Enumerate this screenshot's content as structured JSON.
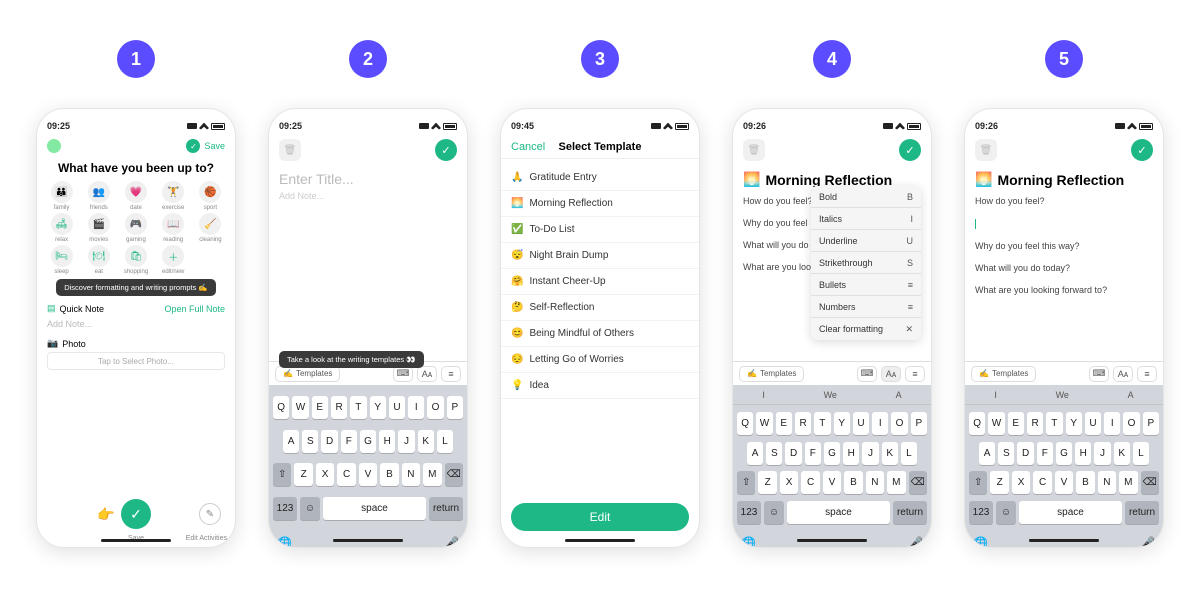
{
  "steps": [
    "1",
    "2",
    "3",
    "4",
    "5"
  ],
  "statusbar": {
    "time1": "09:25",
    "time2": "09:25",
    "time3": "09:45",
    "time4": "09:26",
    "time5": "09:26"
  },
  "s1": {
    "save": "Save",
    "title": "What have you been up to?",
    "activities": [
      {
        "icon": "👪",
        "label": "family"
      },
      {
        "icon": "👥",
        "label": "friends"
      },
      {
        "icon": "💗",
        "label": "date"
      },
      {
        "icon": "🏋",
        "label": "exercise"
      },
      {
        "icon": "🏀",
        "label": "sport"
      },
      {
        "icon": "🛋",
        "label": "relax"
      },
      {
        "icon": "🎬",
        "label": "movies"
      },
      {
        "icon": "🎮",
        "label": "gaming"
      },
      {
        "icon": "📖",
        "label": "reading"
      },
      {
        "icon": "🧹",
        "label": "cleaning"
      },
      {
        "icon": "🛏",
        "label": "sleep"
      },
      {
        "icon": "🍽",
        "label": "eat"
      },
      {
        "icon": "🛍",
        "label": "shopping"
      },
      {
        "icon": "＋",
        "label": "edit/new"
      }
    ],
    "tooltip": "Discover formatting and writing prompts ✍️",
    "quickNote": "Quick Note",
    "openFull": "Open Full Note",
    "addNote": "Add Note...",
    "photo": "Photo",
    "tapPhoto": "Tap to Select Photo...",
    "saveLabel": "Save",
    "editActs": "Edit Activities"
  },
  "s2": {
    "titlePh": "Enter Title...",
    "bodyPh": "Add Note...",
    "tooltip": "Take a look at the writing templates 👀",
    "templates": "Templates"
  },
  "s3": {
    "cancel": "Cancel",
    "header": "Select Template",
    "templates": [
      {
        "icon": "🙏",
        "label": "Gratitude Entry"
      },
      {
        "icon": "🌅",
        "label": "Morning Reflection"
      },
      {
        "icon": "✅",
        "label": "To-Do List"
      },
      {
        "icon": "😴",
        "label": "Night Brain Dump"
      },
      {
        "icon": "🤗",
        "label": "Instant Cheer-Up"
      },
      {
        "icon": "🤔",
        "label": "Self-Reflection"
      },
      {
        "icon": "😊",
        "label": "Being Mindful of Others"
      },
      {
        "icon": "😔",
        "label": "Letting Go of Worries"
      },
      {
        "icon": "💡",
        "label": "Idea"
      }
    ],
    "edit": "Edit"
  },
  "editor": {
    "icon": "🌅",
    "title": "Morning Reflection",
    "prompts": [
      "How do you feel?",
      "Why do you feel this way?",
      "What will you do today?",
      "What are you looking forward to?"
    ],
    "prompts_trunc": [
      "How do you feel?",
      "Why do you feel",
      "What will you do",
      "What are you loo"
    ],
    "templates": "Templates"
  },
  "format_menu": [
    {
      "label": "Bold",
      "sym": "B"
    },
    {
      "label": "Italics",
      "sym": "I"
    },
    {
      "label": "Underline",
      "sym": "U"
    },
    {
      "label": "Strikethrough",
      "sym": "S"
    },
    {
      "label": "Bullets",
      "sym": "≡"
    },
    {
      "label": "Numbers",
      "sym": "≡"
    },
    {
      "label": "Clear formatting",
      "sym": "✕"
    }
  ],
  "kb": {
    "suggestions": [
      "I",
      "We",
      "A"
    ],
    "r1": [
      "Q",
      "W",
      "E",
      "R",
      "T",
      "Y",
      "U",
      "I",
      "O",
      "P"
    ],
    "r2": [
      "A",
      "S",
      "D",
      "F",
      "G",
      "H",
      "J",
      "K",
      "L"
    ],
    "r3": [
      "⇧",
      "Z",
      "X",
      "C",
      "V",
      "B",
      "N",
      "M",
      "⌫"
    ],
    "numKey": "123",
    "space": "space",
    "ret": "return"
  }
}
